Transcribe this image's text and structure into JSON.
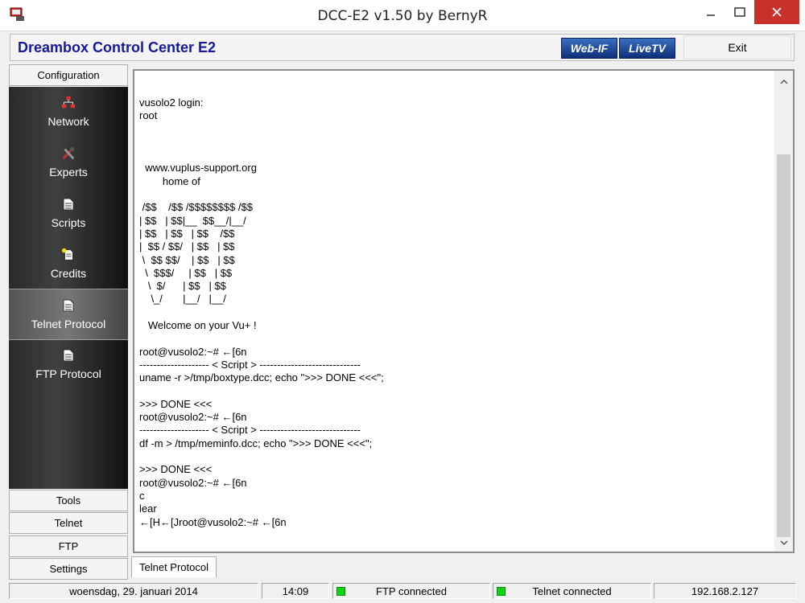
{
  "window": {
    "title": "DCC-E2 v1.50 by BernyR"
  },
  "header": {
    "app_title": "Dreambox Control Center E2",
    "webif_label": "Web-IF",
    "livetv_label": "LiveTV",
    "exit_label": "Exit"
  },
  "sidebar": {
    "top_tab": "Configuration",
    "items": [
      {
        "label": "Network",
        "icon": "network-icon"
      },
      {
        "label": "Experts",
        "icon": "tools-icon"
      },
      {
        "label": "Scripts",
        "icon": "document-icon"
      },
      {
        "label": "Credits",
        "icon": "credits-icon"
      },
      {
        "label": "Telnet Protocol",
        "icon": "document-icon"
      },
      {
        "label": "FTP Protocol",
        "icon": "document-icon"
      }
    ],
    "bottom_tabs": [
      "Tools",
      "Telnet",
      "FTP",
      "Settings"
    ]
  },
  "terminal": {
    "lines": [
      "vusolo2 login:",
      "root",
      "",
      "",
      "",
      "  www.vuplus-support.org",
      "        home of",
      "",
      " /$$    /$$ /$$$$$$$$ /$$",
      "| $$   | $$|__  $$__/|__/",
      "| $$   | $$   | $$    /$$",
      "|  $$ / $$/   | $$   | $$",
      " \\  $$ $$/    | $$   | $$",
      "  \\  $$$/     | $$   | $$",
      "   \\  $/      | $$   | $$",
      "    \\_/       |__/   |__/",
      "",
      "   Welcome on your Vu+ !",
      "",
      "root@vusolo2:~# ←[6n",
      "-------------------- < Script > -----------------------------",
      "uname -r >/tmp/boxtype.dcc; echo \">>> DONE <<<\";",
      "",
      ">>> DONE <<<",
      "root@vusolo2:~# ←[6n",
      "-------------------- < Script > -----------------------------",
      "df -m > /tmp/meminfo.dcc; echo \">>> DONE <<<\";",
      "",
      ">>> DONE <<<",
      "root@vusolo2:~# ←[6n",
      "c",
      "lear",
      "←[H←[Jroot@vusolo2:~# ←[6n"
    ]
  },
  "bottom_tab": {
    "label": "Telnet Protocol"
  },
  "statusbar": {
    "date": "woensdag, 29. januari 2014",
    "time": "14:09",
    "ftp_status": "FTP connected",
    "telnet_status": "Telnet connected",
    "ip": "192.168.2.127",
    "led_color": "#0fd40f"
  }
}
